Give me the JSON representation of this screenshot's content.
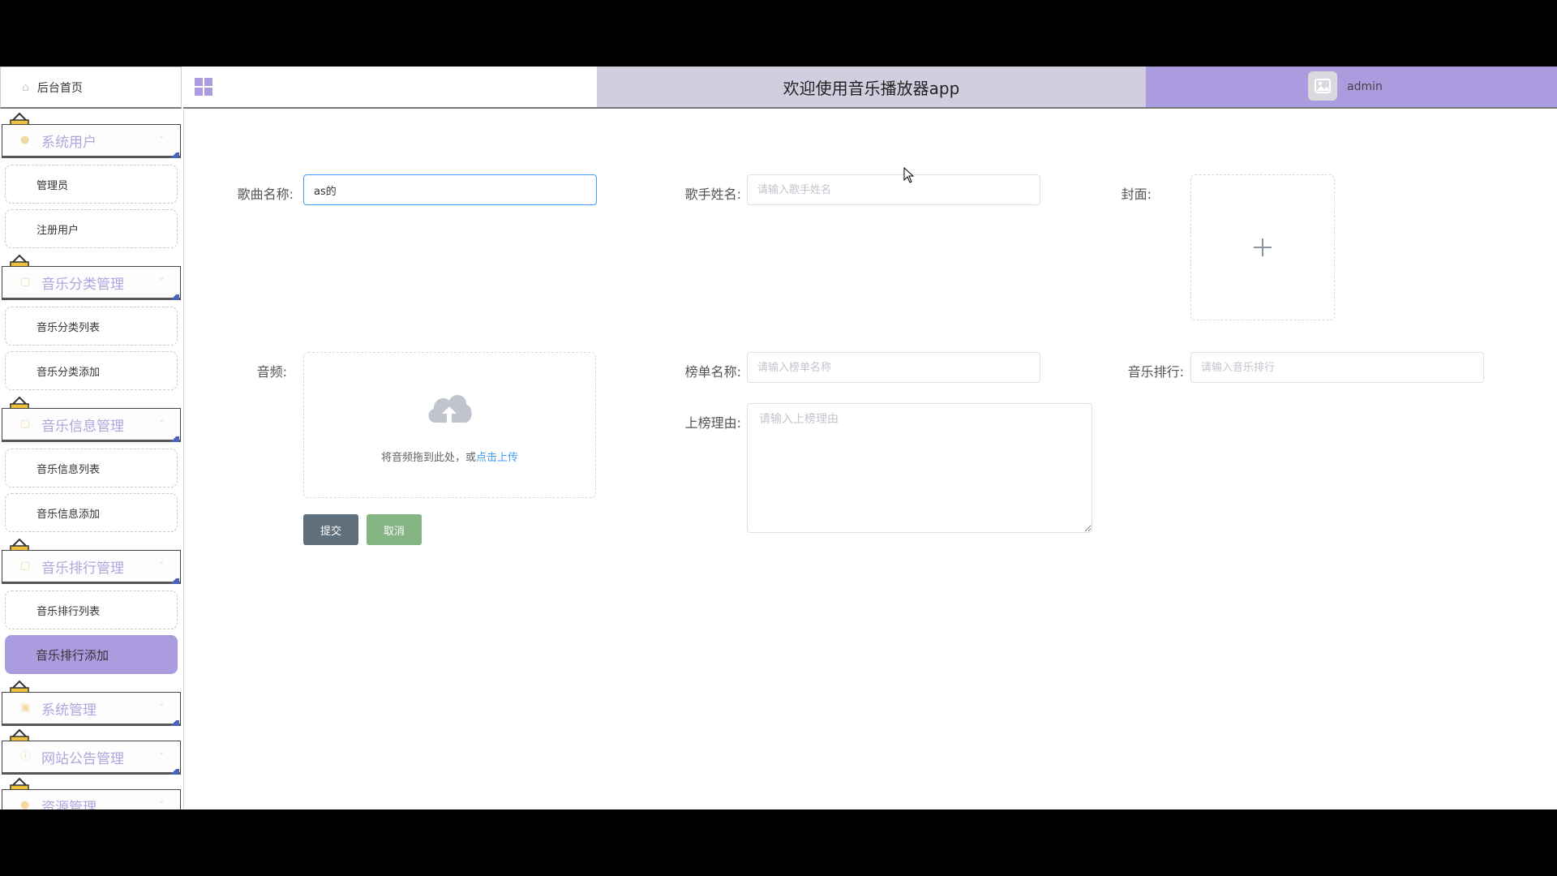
{
  "sidebar": {
    "home": "后台首页",
    "groups": [
      {
        "label": "系统用户",
        "items": [
          "管理员",
          "注册用户"
        ]
      },
      {
        "label": "音乐分类管理",
        "items": [
          "音乐分类列表",
          "音乐分类添加"
        ]
      },
      {
        "label": "音乐信息管理",
        "items": [
          "音乐信息列表",
          "音乐信息添加"
        ]
      },
      {
        "label": "音乐排行管理",
        "items": [
          "音乐排行列表",
          "音乐排行添加"
        ]
      },
      {
        "label": "系统管理",
        "items": []
      },
      {
        "label": "网站公告管理",
        "items": []
      },
      {
        "label": "资源管理",
        "items": []
      }
    ],
    "active_item": "音乐排行添加"
  },
  "header": {
    "title": "欢迎使用音乐播放器app",
    "user": "admin"
  },
  "form": {
    "song_name": {
      "label": "歌曲名称:",
      "value": "as的"
    },
    "singer_name": {
      "label": "歌手姓名:",
      "placeholder": "请输入歌手姓名"
    },
    "cover": {
      "label": "封面:"
    },
    "audio": {
      "label": "音频:",
      "hint": "将音频拖到此处，或",
      "link": "点击上传"
    },
    "chart_name": {
      "label": "榜单名称:",
      "placeholder": "请输入榜单名称"
    },
    "music_rank": {
      "label": "音乐排行:",
      "placeholder": "请输入音乐排行"
    },
    "reason": {
      "label": "上榜理由:",
      "placeholder": "请输入上榜理由"
    },
    "submit": "提交",
    "cancel": "取消"
  },
  "colors": {
    "accent": "#ab9bdf",
    "header_center": "#d3cde0",
    "submit": "#5f6f7b",
    "cancel": "#86b584",
    "link": "#409eff"
  }
}
